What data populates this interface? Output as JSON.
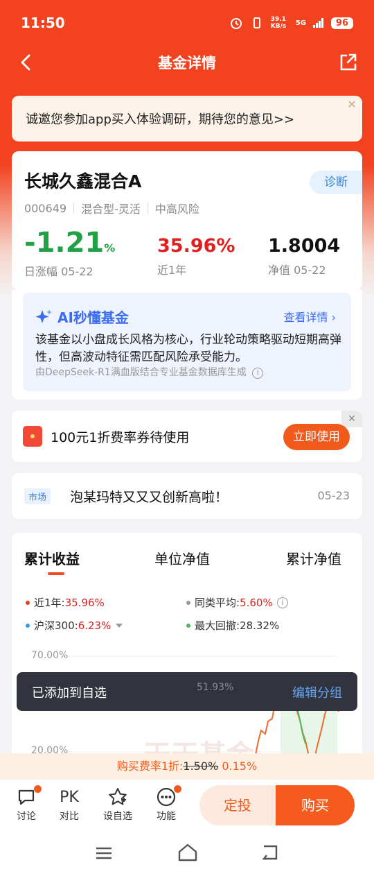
{
  "status_bar": {
    "time": "11:50",
    "net_speed": "39.1\nKB/s",
    "signal": "5G",
    "battery": "96"
  },
  "nav": {
    "title": "基金详情"
  },
  "survey": {
    "text": "诚邀您参加app买入体验调研，期待您的意见>>",
    "close": "✕"
  },
  "fund": {
    "name": "长城久鑫混合A",
    "diagnose_label": "诊断",
    "code": "000649",
    "type": "混合型-灵活",
    "risk": "中高风险",
    "daily_change": "-1.21",
    "daily_change_unit": "%",
    "daily_change_label": "日涨幅 05-22",
    "year_return": "35.96%",
    "year_return_label": "近1年",
    "nav_value": "1.8004",
    "nav_label": "净值 05-22"
  },
  "ai": {
    "title": "AI秒懂基金",
    "more": "查看详情 ›",
    "body": "该基金以小盘成长风格为核心，行业轮动策略驱动短期高弹性，但高波动特征需匹配风险承受能力。",
    "footer": "由DeepSeek-R1满血版结合专业基金数据库生成"
  },
  "coupon": {
    "text": "100元1折费率券待使用",
    "button": "立即使用",
    "close": "✕"
  },
  "news": {
    "tag": "市场",
    "text": "泡某玛特又又又创新高啦！",
    "date": "05-23"
  },
  "chart": {
    "tabs": [
      "累计收益",
      "单位净值",
      "累计净值"
    ],
    "legend": {
      "fund_label": "近1年:",
      "fund_value": "35.96%",
      "peer_label": "同类平均:",
      "peer_value": "5.60%",
      "index_label": "沪深300:",
      "index_value": "6.23%",
      "drawdown_label": "最大回撤:",
      "drawdown_value": "28.32%"
    },
    "y_labels": [
      "70.00%",
      "20.00%"
    ],
    "peak_label": "51.93%",
    "watermark": "天天基金"
  },
  "colors": {
    "brand": "#f2421f",
    "up": "#e02020",
    "down": "#22a046",
    "fund_dot": "#e8401c",
    "index_dot": "#3a9be8",
    "peer_dot": "#999999",
    "drawdown_dot": "#4cbb5a"
  },
  "toast": {
    "text": "已添加到自选",
    "action": "编辑分组"
  },
  "fee": {
    "label": "购买费率1折:",
    "old": "1.50%",
    "new": "0.15%"
  },
  "bottom": {
    "items": [
      {
        "label": "讨论",
        "icon": "chat-bubble-icon"
      },
      {
        "label": "对比",
        "icon": "PK"
      },
      {
        "label": "设自选",
        "icon": "star-icon"
      },
      {
        "label": "功能",
        "icon": "more-dots-icon"
      }
    ],
    "dingtou": "定投",
    "buy": "购买"
  }
}
